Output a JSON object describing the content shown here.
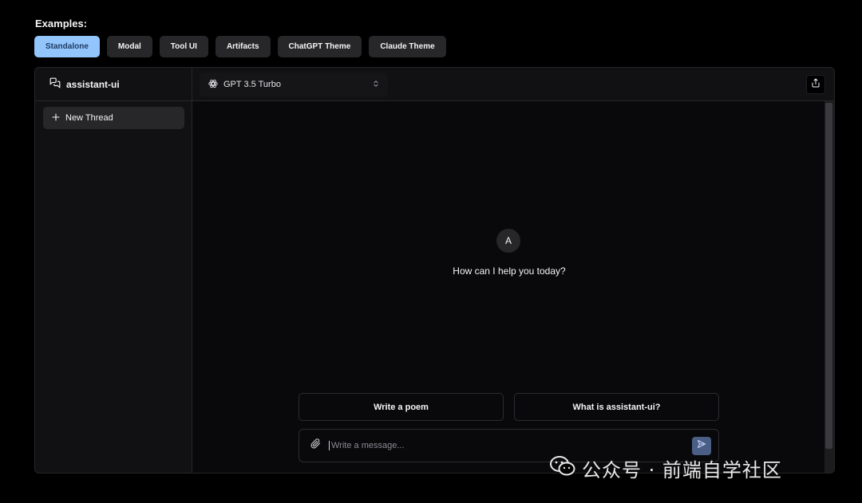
{
  "examples": {
    "title": "Examples:",
    "tabs": [
      {
        "label": "Standalone",
        "active": true
      },
      {
        "label": "Modal"
      },
      {
        "label": "Tool UI"
      },
      {
        "label": "Artifacts"
      },
      {
        "label": "ChatGPT Theme"
      },
      {
        "label": "Claude Theme"
      }
    ]
  },
  "sidebar": {
    "brand": "assistant-ui",
    "brand_icon": "chat-bubbles-icon",
    "new_thread_label": "New Thread",
    "new_thread_icon": "plus-icon"
  },
  "topbar": {
    "model_label": "GPT 3.5 Turbo",
    "model_icon": "openai-icon",
    "share_icon": "share-icon"
  },
  "thread": {
    "avatar_letter": "A",
    "welcome": "How can I help you today?",
    "suggestions": [
      "Write a poem",
      "What is assistant-ui?"
    ]
  },
  "composer": {
    "placeholder": "Write a message...",
    "attach_icon": "paperclip-icon",
    "send_icon": "send-icon"
  },
  "watermark": "公众号 · 前端自学社区",
  "colors": {
    "active_tab": "#93c5fd",
    "send_button": "#4b5e86",
    "background": "#000000"
  }
}
